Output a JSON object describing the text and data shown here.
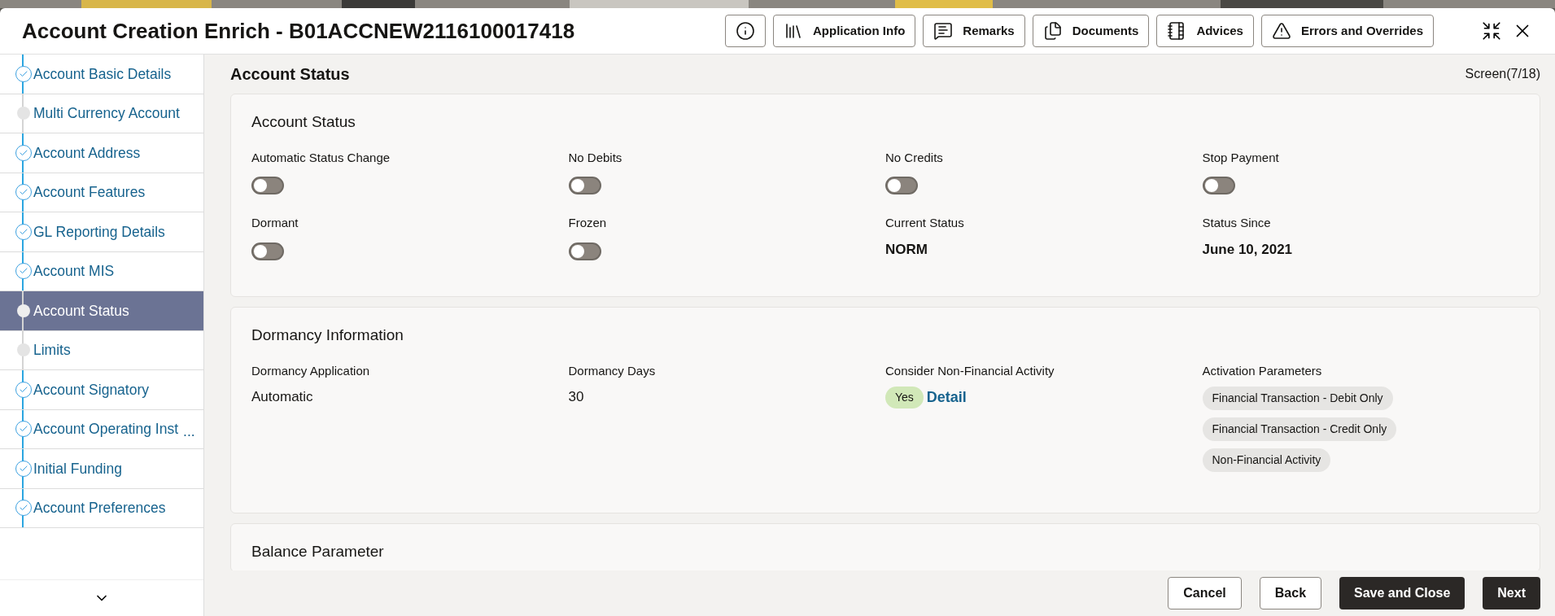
{
  "window": {
    "title": "Account Creation Enrich - B01ACCNEW2116100017418"
  },
  "header_buttons": [
    {
      "kind": "info"
    },
    {
      "kind": "books",
      "label": "Application Info"
    },
    {
      "kind": "chat",
      "label": "Remarks"
    },
    {
      "kind": "docs",
      "label": "Documents"
    },
    {
      "kind": "notebook",
      "label": "Advices"
    },
    {
      "kind": "warning",
      "label": "Errors and Overrides"
    }
  ],
  "sidebar": {
    "items": [
      {
        "label": "Account Basic Details",
        "kind": "done",
        "selected": false
      },
      {
        "label": "Multi Currency Account",
        "kind": "pending",
        "selected": false
      },
      {
        "label": "Account Address",
        "kind": "done",
        "selected": false
      },
      {
        "label": "Account Features",
        "kind": "done",
        "selected": false
      },
      {
        "label": "GL Reporting Details",
        "kind": "done",
        "selected": false
      },
      {
        "label": "Account MIS",
        "kind": "done",
        "selected": false
      },
      {
        "label": "Account Status",
        "kind": "pending",
        "selected": true
      },
      {
        "label": "Limits",
        "kind": "pending",
        "selected": false
      },
      {
        "label": "Account Signatory",
        "kind": "done",
        "selected": false
      },
      {
        "label": "Account Operating Inst",
        "kind": "done",
        "selected": false,
        "more": "..."
      },
      {
        "label": "Initial Funding",
        "kind": "done",
        "selected": false
      },
      {
        "label": "Account Preferences",
        "kind": "done",
        "selected": false
      }
    ]
  },
  "page": {
    "title": "Account Status",
    "screen": "Screen(7/18)"
  },
  "account_status": {
    "title": "Account Status",
    "fields": [
      {
        "kind": "toggle",
        "label": "Automatic Status Change",
        "on": false
      },
      {
        "kind": "toggle",
        "label": "No Debits",
        "on": false
      },
      {
        "kind": "toggle",
        "label": "No Credits",
        "on": false
      },
      {
        "kind": "toggle",
        "label": "Stop Payment",
        "on": false
      },
      {
        "kind": "toggle",
        "label": "Dormant",
        "on": false
      },
      {
        "kind": "toggle",
        "label": "Frozen",
        "on": false
      },
      {
        "kind": "value",
        "label": "Current Status",
        "value": "NORM"
      },
      {
        "kind": "value",
        "label": "Status Since",
        "value": "June 10, 2021"
      }
    ]
  },
  "dormancy": {
    "title": "Dormancy Information",
    "fields": [
      {
        "kind": "text",
        "label": "Dormancy Application",
        "value": "Automatic"
      },
      {
        "kind": "text",
        "label": "Dormancy Days",
        "value": "30"
      },
      {
        "kind": "badge",
        "label": "Consider Non-Financial Activity",
        "value": "Yes",
        "link": "Detail"
      },
      {
        "kind": "chips",
        "label": "Activation Parameters",
        "chips": [
          "Financial Transaction - Debit Only",
          "Financial Transaction - Credit Only",
          "Non-Financial Activity"
        ]
      }
    ]
  },
  "balance": {
    "title": "Balance Parameter"
  },
  "footer_buttons": [
    {
      "label": "Cancel",
      "kind": "outline"
    },
    {
      "label": "Back",
      "kind": "outline"
    },
    {
      "label": "Save and Close",
      "kind": "solid"
    },
    {
      "label": "Next",
      "kind": "solid"
    }
  ]
}
